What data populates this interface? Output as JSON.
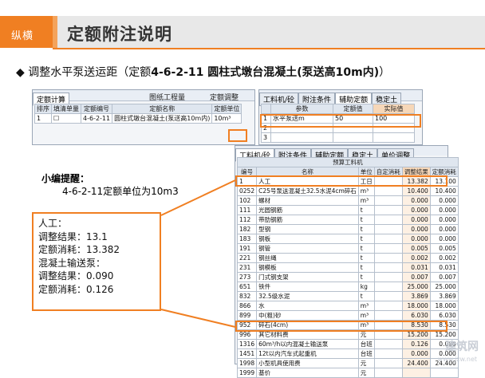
{
  "header": {
    "logo": "纵横",
    "title": "定额附注说明"
  },
  "bullet": {
    "symbol": "◆",
    "text": "调整水平泵送运距（定额",
    "bold": "4-6-2-11  圆柱式墩台混凝土(泵送高10m内)",
    "tail": "）"
  },
  "window1": {
    "tabs": [
      "定额计算",
      "图纸工程量",
      "定额调整"
    ],
    "headers": [
      "排序",
      "填清单量",
      "定额编号",
      "定额名称",
      "定额单位"
    ],
    "row": [
      "1",
      "",
      "4-6-2-11",
      "圆柱式墩台混凝土(泵送高10m内)",
      "10m³"
    ]
  },
  "window2": {
    "tabs": [
      "工料机/砼",
      "附注条件",
      "辅助定额",
      "稳定土"
    ],
    "headers": [
      "",
      "参数",
      "定额值",
      "实际值"
    ],
    "rows": [
      [
        "1",
        "水平泵送m",
        "50",
        "100"
      ],
      [
        "2",
        "",
        "",
        ""
      ],
      [
        "3",
        "",
        "",
        ""
      ]
    ]
  },
  "window3": {
    "tabs": [
      "工料机/砼",
      "附注条件",
      "辅助定额",
      "稳定土",
      "单价调整"
    ],
    "group": "预算工料机",
    "headers": [
      "编号",
      "名称",
      "单位",
      "自定消耗",
      "调整结果",
      "定额消耗"
    ],
    "rows": [
      [
        "1",
        "人工",
        "工日",
        "",
        "13.382",
        "13.100"
      ],
      [
        "0252",
        "C25号泵送混凝土32.5水泥4cm碎石",
        "m³",
        "",
        "10.400",
        "10.400"
      ],
      [
        "102",
        "螺材",
        "m³",
        "",
        "0.000",
        "0.000"
      ],
      [
        "111",
        "光圆钢筋",
        "t",
        "",
        "0.000",
        "0.000"
      ],
      [
        "112",
        "带肋钢筋",
        "t",
        "",
        "0.000",
        "0.000"
      ],
      [
        "182",
        "型钢",
        "t",
        "",
        "0.000",
        "0.000"
      ],
      [
        "183",
        "钢板",
        "t",
        "",
        "0.000",
        "0.000"
      ],
      [
        "191",
        "钢管",
        "t",
        "",
        "0.005",
        "0.005"
      ],
      [
        "221",
        "钢丝绳",
        "t",
        "",
        "0.002",
        "0.002"
      ],
      [
        "231",
        "钢模板",
        "t",
        "",
        "0.031",
        "0.031"
      ],
      [
        "273",
        "门式钢支架",
        "t",
        "",
        "0.007",
        "0.007"
      ],
      [
        "651",
        "铁件",
        "kg",
        "",
        "25.000",
        "25.000"
      ],
      [
        "832",
        "32.5级水泥",
        "t",
        "",
        "3.869",
        "3.869"
      ],
      [
        "866",
        "水",
        "m³",
        "",
        "18.000",
        "18.000"
      ],
      [
        "899",
        "中(粗)砂",
        "m³",
        "",
        "6.030",
        "6.030"
      ],
      [
        "952",
        "碎石(4cm)",
        "m³",
        "",
        "8.530",
        "8.530"
      ],
      [
        "996",
        "其它材料费",
        "元",
        "",
        "15.200",
        "15.200"
      ],
      [
        "1316",
        "60m³/h以内混凝土输送泵",
        "台班",
        "",
        "0.126",
        "0.090"
      ],
      [
        "1451",
        "12t以内汽车式起重机",
        "台班",
        "",
        "0.000",
        "0.000"
      ],
      [
        "1998",
        "小型机具使用费",
        "元",
        "",
        "24.400",
        "24.400"
      ],
      [
        "1999",
        "基价",
        "元",
        "",
        "",
        ""
      ]
    ]
  },
  "tip": {
    "title": "小编提醒：",
    "body": "4-6-2-11定额单位为10m3"
  },
  "info": [
    "人工：",
    "调整结果：13.1",
    "定额消耗：13.382",
    "混凝土输送泵：",
    "调整结果：0.090",
    "定额消耗：0.126"
  ],
  "watermark": {
    "main": "建筑网",
    "sub": "www.jzw.net"
  },
  "colors": {
    "accent": "#f07f22"
  }
}
